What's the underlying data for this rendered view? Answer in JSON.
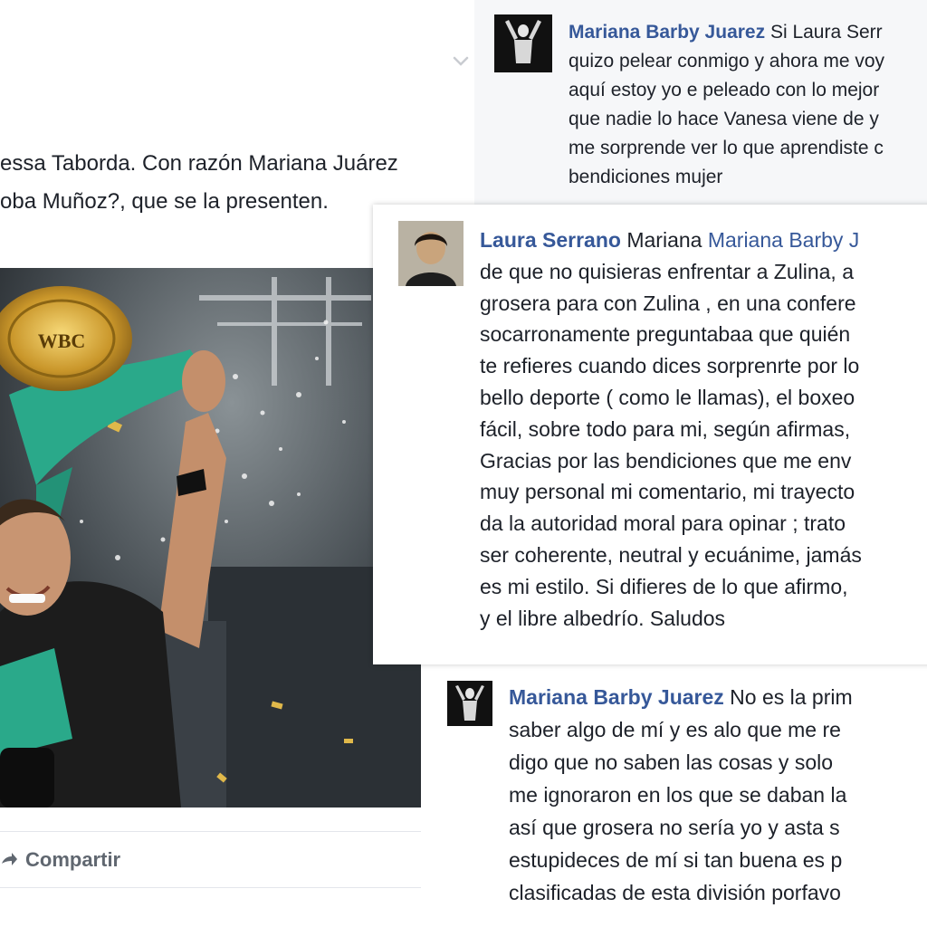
{
  "post": {
    "text_lines": [
      "essa Taborda. Con razón Mariana Juárez",
      "oba Muñoz?, que se la presenten."
    ],
    "share_label": "Compartir",
    "photo": {
      "belt_label": "WBC"
    }
  },
  "comments": [
    {
      "author": "Mariana Barby Juarez",
      "first_line_rest": " Si Laura Serr",
      "lines": [
        "quizo pelear conmigo y ahora me voy",
        "aquí estoy yo e peleado con lo mejor",
        "que nadie lo hace Vanesa viene de y",
        "me sorprende ver lo que aprendiste c",
        "bendiciones mujer"
      ]
    },
    {
      "author": "Laura Serrano",
      "first_line_rest": " Mariana ",
      "mention": "Mariana Barby J",
      "lines": [
        "de que no quisieras enfrentar a Zulina, a",
        "grosera para con Zulina , en una confere",
        "socarronamente preguntabaa que quién",
        "te refieres cuando dices sorprenrte por lo",
        "bello deporte ( como le llamas), el boxeo",
        "fácil, sobre todo para mi, según afirmas,",
        "Gracias por las bendiciones que me env",
        "muy personal mi comentario, mi trayecto",
        "da la autoridad moral para opinar ; trato",
        "ser coherente, neutral y ecuánime, jamás",
        "es mi estilo. Si difieres de lo que afirmo,",
        "y el libre albedrío. Saludos"
      ]
    },
    {
      "author": "Mariana Barby Juarez",
      "first_line_rest": " No es la prim",
      "lines": [
        "saber algo de mí y es alo que me re",
        "digo que no saben las cosas y solo",
        "me ignoraron en los que se daban la",
        "así que grosera no sería yo y asta s",
        "estupideces de mí si tan buena es p",
        "clasificadas de esta división porfavo"
      ]
    }
  ],
  "colors": {
    "author_link": "#365899",
    "text": "#1d2129",
    "belt_green": "#2aa98a",
    "belt_gold": "#d4a62a"
  },
  "icons": {
    "chevron": "chevron-down-icon",
    "share": "share-icon"
  }
}
